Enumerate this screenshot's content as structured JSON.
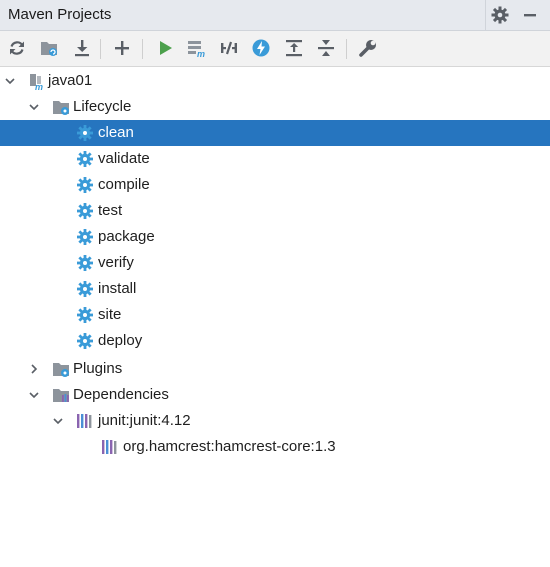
{
  "panel": {
    "title": "Maven Projects"
  },
  "colors": {
    "selection": "#2675bf",
    "gear_blue": "#3a9bd8",
    "run_green": "#4ca04c",
    "lib_purple": "#8a64b0",
    "lib_blue": "#4a8fd6"
  },
  "header_icons": [
    "gear-icon",
    "hide-icon"
  ],
  "toolbar": [
    "reimport-icon",
    "generate-sources-icon",
    "download-icon",
    "add-icon",
    "run-icon",
    "execute-goal-icon",
    "toggle-offline-icon",
    "skip-tests-icon",
    "show-dependencies-icon",
    "collapse-all-icon",
    "settings-wrench-icon"
  ],
  "tree": {
    "project": {
      "label": "java01"
    },
    "lifecycle": {
      "label": "Lifecycle",
      "goals": [
        {
          "label": "clean"
        },
        {
          "label": "validate"
        },
        {
          "label": "compile"
        },
        {
          "label": "test"
        },
        {
          "label": "package"
        },
        {
          "label": "verify"
        },
        {
          "label": "install"
        },
        {
          "label": "site"
        },
        {
          "label": "deploy"
        }
      ]
    },
    "plugins": {
      "label": "Plugins"
    },
    "dependencies": {
      "label": "Dependencies",
      "items": [
        {
          "label": "junit:junit:4.12"
        }
      ],
      "transitive": [
        {
          "label": "org.hamcrest:hamcrest-core:1.3"
        }
      ]
    }
  }
}
